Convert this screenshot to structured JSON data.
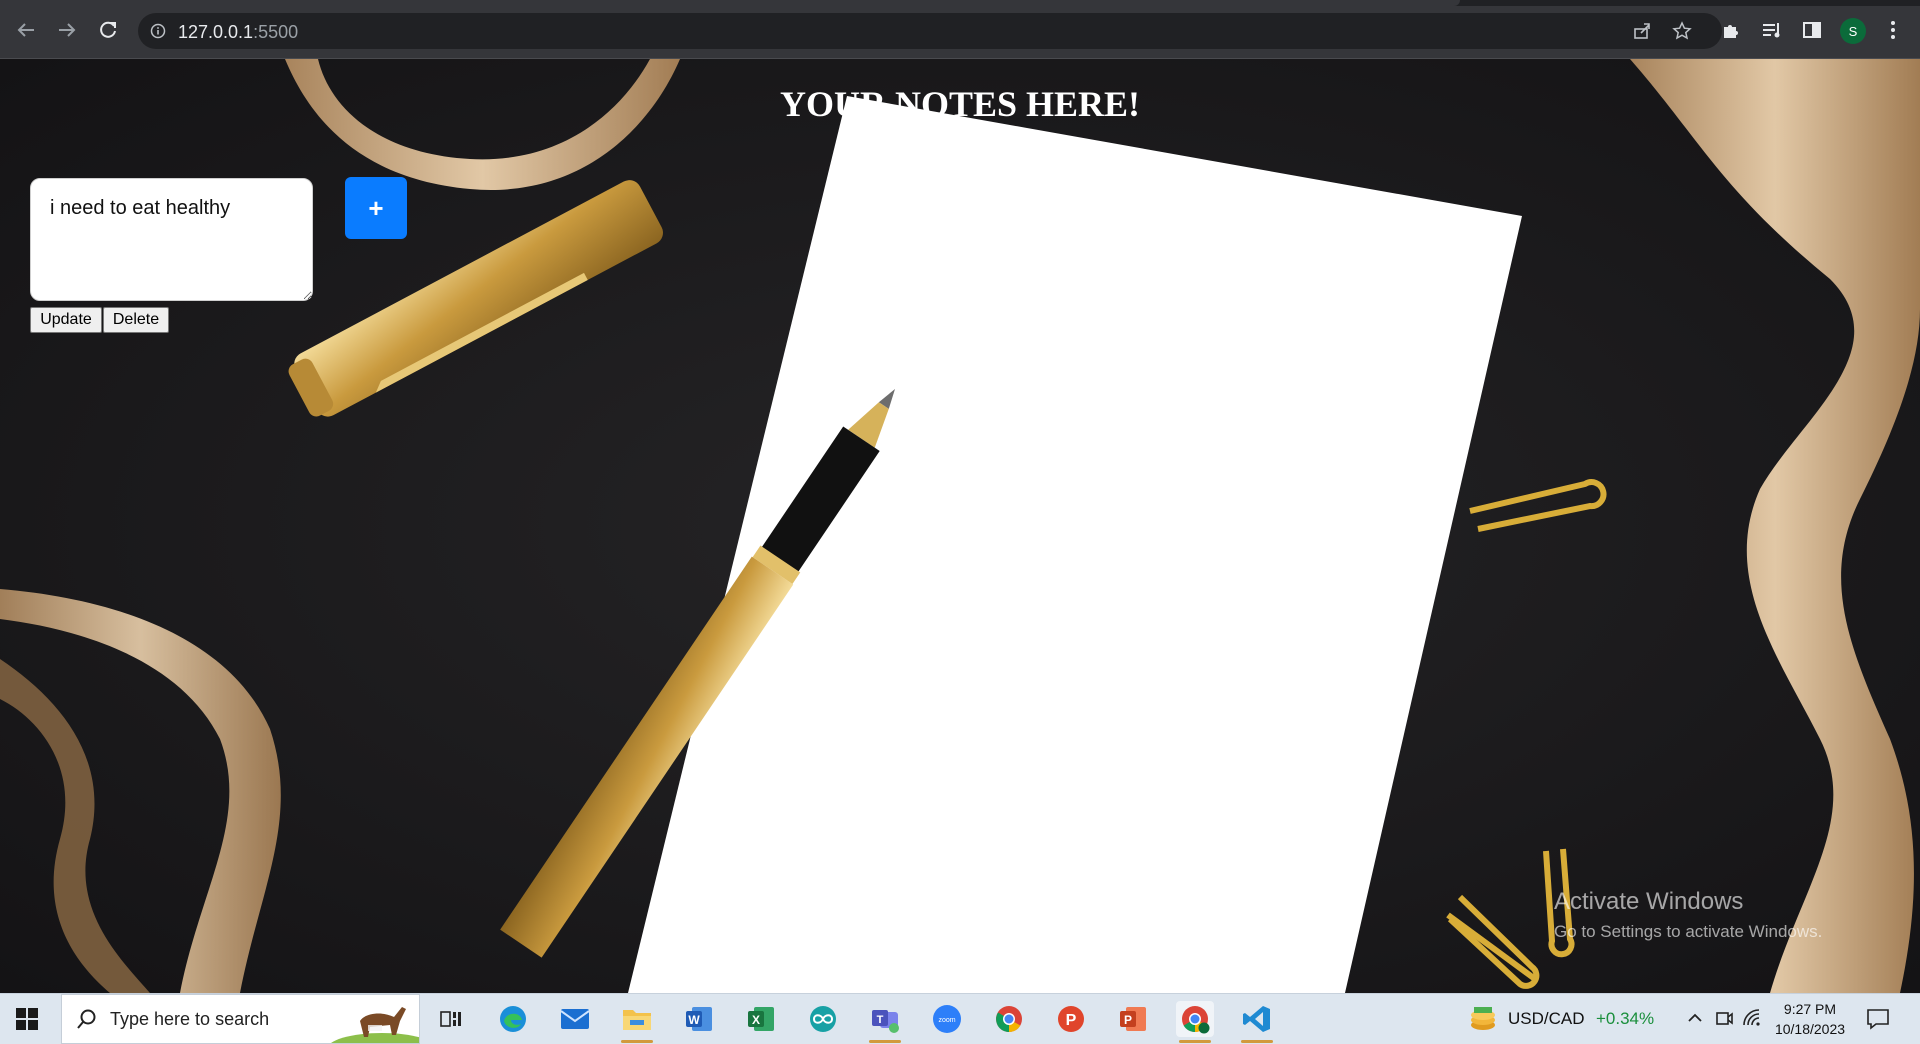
{
  "browser": {
    "url_host": "127.0.0.1",
    "url_port": ":5500",
    "profile_initial": "S",
    "icons": [
      "back-arrow-icon",
      "forward-arrow-icon",
      "reload-icon",
      "site-info-icon",
      "share-icon",
      "bookmark-star-icon",
      "extensions-icon",
      "reading-list-icon",
      "side-panel-icon",
      "kebab-menu-icon"
    ]
  },
  "page": {
    "title": "YOUR NOTES HERE!",
    "note_text": "i need to eat healthy",
    "add_label": "+",
    "update_label": "Update",
    "delete_label": "Delete"
  },
  "watermark": {
    "line1": "Activate Windows",
    "line2": "Go to Settings to activate Windows."
  },
  "taskbar": {
    "search_placeholder": "Type here to search",
    "apps": [
      "task-view",
      "edge",
      "mail",
      "file-explorer",
      "word",
      "excel",
      "arduino",
      "teams",
      "zoom",
      "chrome",
      "polaris",
      "powerpoint",
      "chrome-profile",
      "vscode"
    ],
    "currency_pair": "USD/CAD",
    "currency_change": "+0.34%",
    "time": "9:27 PM",
    "date": "10/18/2023"
  },
  "colors": {
    "accent_blue": "#0a7cff",
    "chrome_bg": "#35363a",
    "taskbar_bg": "#dde6ef",
    "currency_positive": "#1a8f3c"
  }
}
